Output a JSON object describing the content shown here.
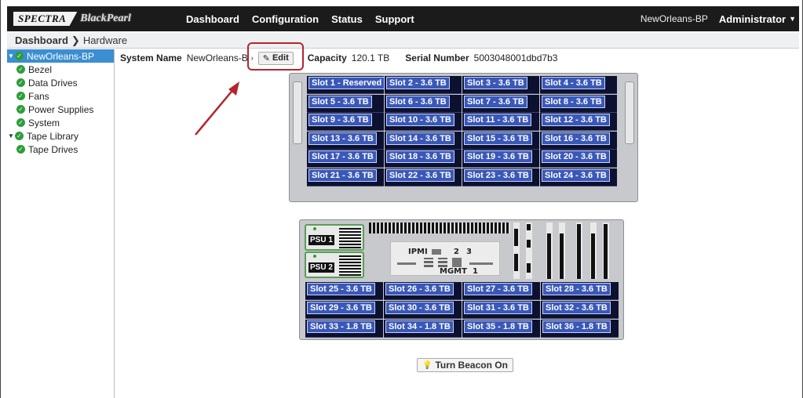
{
  "brand": {
    "name": "SPECTRA",
    "product": "BlackPearl"
  },
  "nav": [
    "Dashboard",
    "Configuration",
    "Status",
    "Support"
  ],
  "header": {
    "hostname": "NewOrleans-BP",
    "user": "Administrator"
  },
  "breadcrumb": {
    "root": "Dashboard",
    "current": "Hardware"
  },
  "sidebar": {
    "items": [
      {
        "label": "NewOrleans-BP",
        "level": 0,
        "expanded": true,
        "selected": true
      },
      {
        "label": "Bezel",
        "level": 1
      },
      {
        "label": "Data Drives",
        "level": 1
      },
      {
        "label": "Fans",
        "level": 1
      },
      {
        "label": "Power Supplies",
        "level": 1
      },
      {
        "label": "System",
        "level": 1
      },
      {
        "label": "Tape Library",
        "level": 0,
        "expanded": true
      },
      {
        "label": "Tape Drives",
        "level": 1
      }
    ]
  },
  "system": {
    "name_label": "System Name",
    "name_value": "NewOrleans-B",
    "edit_label": "Edit",
    "capacity_label": "Capacity",
    "capacity_value": "120.1 TB",
    "serial_label": "Serial Number",
    "serial_value": "5003048001dbd7b3"
  },
  "front_slots": [
    "Slot 1 - Reserved",
    "Slot 2 - 3.6 TB",
    "Slot 3 - 3.6 TB",
    "Slot 4 - 3.6 TB",
    "Slot 5 - 3.6 TB",
    "Slot 6 - 3.6 TB",
    "Slot 7 - 3.6 TB",
    "Slot 8 - 3.6 TB",
    "Slot 9 - 3.6 TB",
    "Slot 10 - 3.6 TB",
    "Slot 11 - 3.6 TB",
    "Slot 12 - 3.6 TB",
    "Slot 13 - 3.6 TB",
    "Slot 14 - 3.6 TB",
    "Slot 15 - 3.6 TB",
    "Slot 16 - 3.6 TB",
    "Slot 17 - 3.6 TB",
    "Slot 18 - 3.6 TB",
    "Slot 19 - 3.6 TB",
    "Slot 20 - 3.6 TB",
    "Slot 21 - 3.6 TB",
    "Slot 22 - 3.6 TB",
    "Slot 23 - 3.6 TB",
    "Slot 24 - 3.6 TB"
  ],
  "rear": {
    "psu": [
      "PSU 1",
      "PSU 2"
    ],
    "ipmi": "IPMI",
    "mgmt": "MGMT",
    "ports": [
      "2",
      "3",
      "1"
    ]
  },
  "rear_slots": [
    "Slot 25 - 3.6 TB",
    "Slot 26 - 3.6 TB",
    "Slot 27 - 3.6 TB",
    "Slot 28 - 3.6 TB",
    "Slot 29 - 3.6 TB",
    "Slot 30 - 3.6 TB",
    "Slot 31 - 3.6 TB",
    "Slot 32 - 3.6 TB",
    "Slot 33 - 1.8 TB",
    "Slot 34 - 1.8 TB",
    "Slot 35 - 1.8 TB",
    "Slot 36 - 1.8 TB"
  ],
  "beacon": {
    "label": "Turn Beacon On"
  },
  "colors": {
    "topbar": "#1b1b1b",
    "selected": "#3b8ed1",
    "ok": "#2e9d3a",
    "slot_label": "#3a58b8",
    "annotation": "#b3262e"
  }
}
